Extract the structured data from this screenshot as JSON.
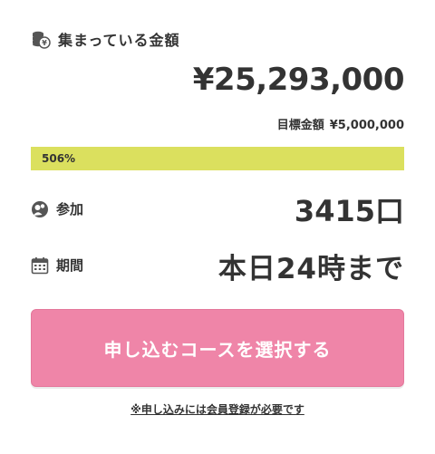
{
  "collected": {
    "label": "集まっている金額",
    "amount": "¥25,293,000"
  },
  "goal": {
    "label": "目標金額",
    "value": "¥5,000,000"
  },
  "progress": {
    "percent_text": "506%",
    "percent": 506
  },
  "participation": {
    "label": "参加",
    "value": "3415口"
  },
  "period": {
    "label": "期間",
    "value": "本日24時まで"
  },
  "cta": {
    "label": "申し込むコースを選択する"
  },
  "note": {
    "text": "※申し込みには会員登録が必要です"
  },
  "icons": {
    "collected": "coins-icon",
    "participation": "people-icon",
    "period": "calendar-icon"
  },
  "colors": {
    "progress_fill": "#dbe05e",
    "cta_bg": "#ef85a8",
    "text": "#333333"
  }
}
